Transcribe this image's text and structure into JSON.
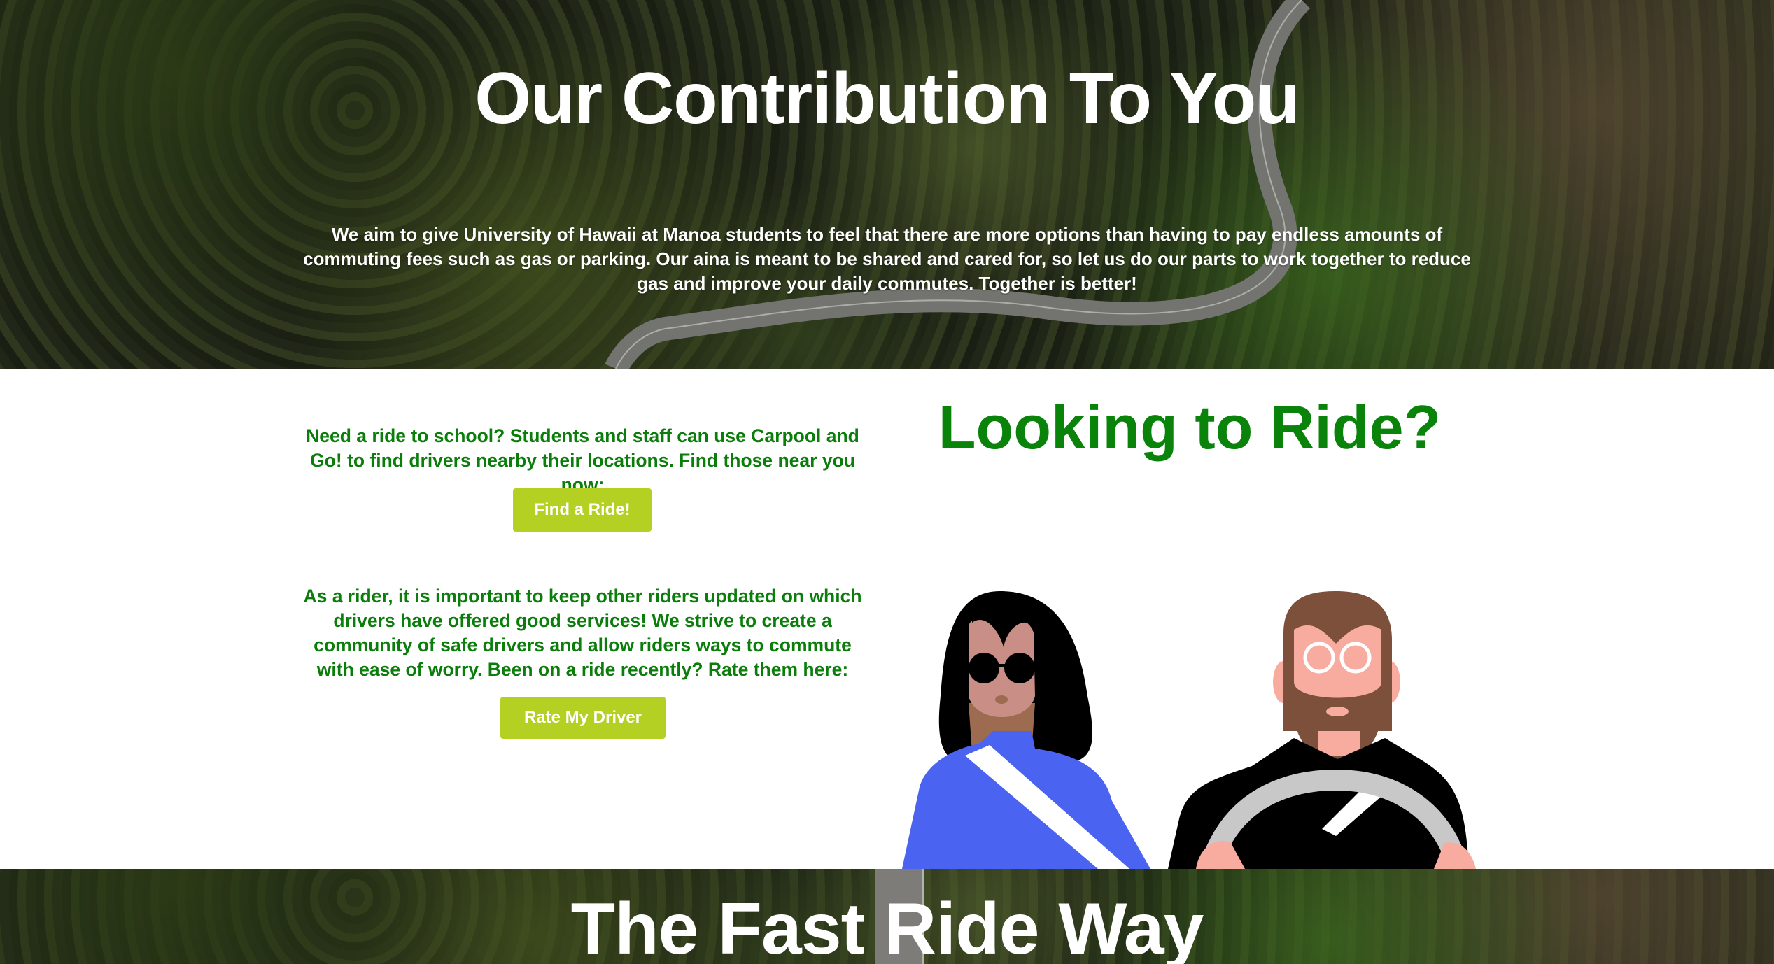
{
  "hero": {
    "title": "Our Contribution To You",
    "text": "We aim to give University of Hawaii at Manoa students to feel that there are more options than having to pay endless amounts of commuting fees such as gas or parking. Our aina is meant to be shared and cared for, so let us do our parts to work together to reduce gas and improve your daily commutes. Together is better!"
  },
  "ride": {
    "title": "Looking to Ride?",
    "find_text": "Need a ride to school? Students and staff can use Carpool and Go! to find drivers nearby their locations. Find those near you now:",
    "find_button": "Find a Ride!",
    "rate_text": "As a rider, it is important to keep other riders updated on which drivers have offered good services! We strive to create a community of safe drivers and allow riders ways to commute with ease of worry. Been on a ride recently? Rate them here:",
    "rate_button": "Rate My Driver"
  },
  "next_section": {
    "title": "The Fast Ride Way"
  },
  "colors": {
    "accent_green": "#0a7d0a",
    "button": "#b3d023"
  }
}
